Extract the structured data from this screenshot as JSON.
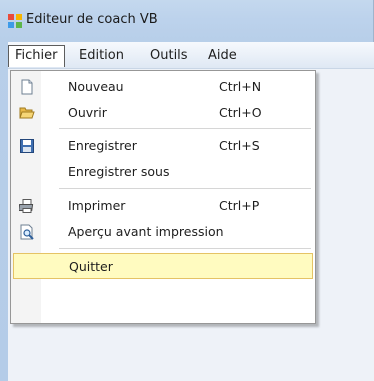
{
  "window": {
    "title": "Editeur de coach VB"
  },
  "menubar": {
    "items": [
      "Fichier",
      "Edition",
      "Outils",
      "Aide"
    ]
  },
  "file_menu": {
    "items": [
      {
        "label": "Nouveau",
        "shortcut": "Ctrl+N",
        "icon": "new-document-icon"
      },
      {
        "label": "Ouvrir",
        "shortcut": "Ctrl+O",
        "icon": "open-folder-icon"
      },
      {
        "label": "Enregistrer",
        "shortcut": "Ctrl+S",
        "icon": "save-disk-icon"
      },
      {
        "label": "Enregistrer sous",
        "shortcut": "",
        "icon": ""
      },
      {
        "label": "Imprimer",
        "shortcut": "Ctrl+P",
        "icon": "printer-icon"
      },
      {
        "label": "Aperçu avant impression",
        "shortcut": "",
        "icon": "print-preview-icon"
      },
      {
        "label": "Quitter",
        "shortcut": "",
        "icon": ""
      }
    ],
    "highlighted": "Quitter"
  },
  "colors": {
    "highlight_fill": "#fffbc0",
    "highlight_border": "#e5c365",
    "frame": "#b8cfe9"
  }
}
